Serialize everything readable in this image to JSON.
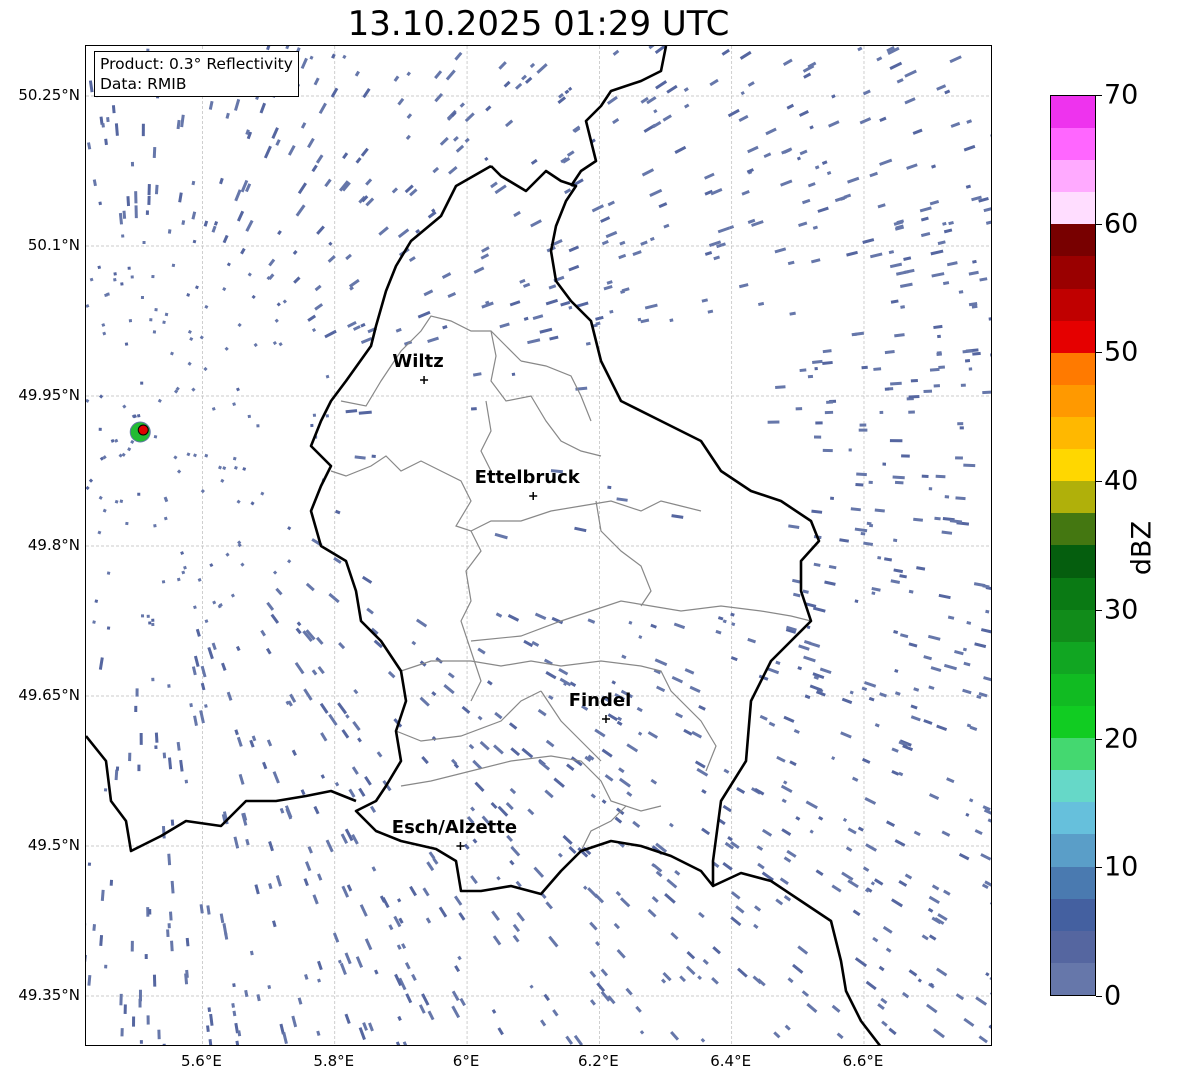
{
  "title": "13.10.2025 01:29 UTC",
  "info": {
    "product": "Product: 0.3° Reflectivity",
    "data": "Data: RMIB"
  },
  "map": {
    "lon_range": [
      5.424,
      6.795
    ],
    "lat_range": [
      49.299,
      50.3
    ],
    "lon_ticks": [
      "5.6°E",
      "5.8°E",
      "6°E",
      "6.2°E",
      "6.4°E",
      "6.6°E"
    ],
    "lon_tick_values": [
      5.6,
      5.8,
      6.0,
      6.2,
      6.4,
      6.6
    ],
    "lat_ticks": [
      "50.25°N",
      "50.1°N",
      "49.95°N",
      "49.8°N",
      "49.65°N",
      "49.5°N",
      "49.35°N"
    ],
    "lat_tick_values": [
      50.25,
      50.1,
      49.95,
      49.8,
      49.65,
      49.5,
      49.35
    ],
    "cities": [
      {
        "name": "Wiltz",
        "lon": 5.935,
        "lat": 49.966
      },
      {
        "name": "Ettelbruck",
        "lon": 6.1,
        "lat": 49.85
      },
      {
        "name": "Findel",
        "lon": 6.21,
        "lat": 49.627
      },
      {
        "name": "Esch/Alzette",
        "lon": 5.99,
        "lat": 49.5
      }
    ],
    "radar_site": {
      "lon": 5.506,
      "lat": 49.914
    }
  },
  "colorbar": {
    "label": "dBZ",
    "ticks": [
      "0",
      "10",
      "20",
      "30",
      "40",
      "50",
      "60",
      "70"
    ],
    "range": [
      0,
      70
    ],
    "colors": [
      "#6677aa",
      "#5566a0",
      "#4460a0",
      "#4a7ab0",
      "#5a9ec8",
      "#66c0dc",
      "#66d8c8",
      "#44d870",
      "#11cc22",
      "#11bb22",
      "#11a622",
      "#118c1a",
      "#0a7a14",
      "#055e0e",
      "#447711",
      "#b0b00a",
      "#ffd700",
      "#ffb800",
      "#ff9900",
      "#ff7a00",
      "#e50000",
      "#c00000",
      "#9a0000",
      "#780000",
      "#ffddff",
      "#ffaaff",
      "#ff66ff",
      "#ee33ee"
    ]
  }
}
